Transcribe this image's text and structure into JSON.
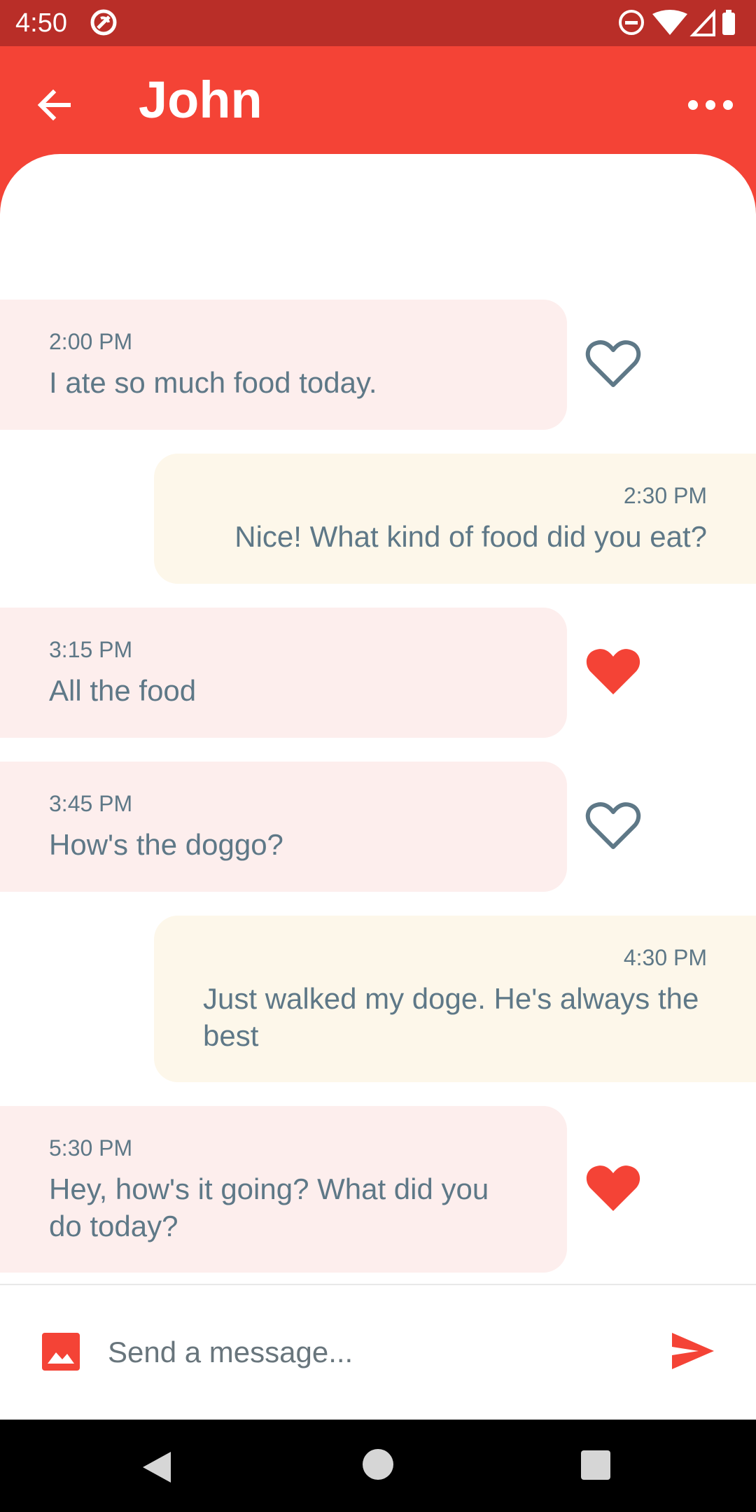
{
  "status_bar": {
    "time": "4:50"
  },
  "header": {
    "title": "John",
    "back_icon": "arrow-back-icon",
    "menu_icon": "more-horizontal-icon"
  },
  "messages": [
    {
      "direction": "incoming",
      "time": "2:00 PM",
      "text": "I ate so much food today.",
      "liked": false
    },
    {
      "direction": "outgoing",
      "time": "2:30 PM",
      "text": "Nice! What kind of food did you eat?"
    },
    {
      "direction": "incoming",
      "time": "3:15 PM",
      "text": "All the food",
      "liked": true
    },
    {
      "direction": "incoming",
      "time": "3:45 PM",
      "text": "How's the doggo?",
      "liked": false
    },
    {
      "direction": "outgoing",
      "time": "4:30 PM",
      "text": "Just walked my doge. He's always the best"
    },
    {
      "direction": "incoming",
      "time": "5:30 PM",
      "text": "Hey, how's it going? What did you do today?",
      "liked": true
    }
  ],
  "composer": {
    "placeholder": "Send a message...",
    "image_icon": "image-icon",
    "send_icon": "send-icon"
  },
  "colors": {
    "primary": "#f44336",
    "status_bar": "#b92e28",
    "incoming_bubble": "#fdeeed",
    "outgoing_bubble": "#fdf7ea",
    "text": "#5e7887"
  }
}
